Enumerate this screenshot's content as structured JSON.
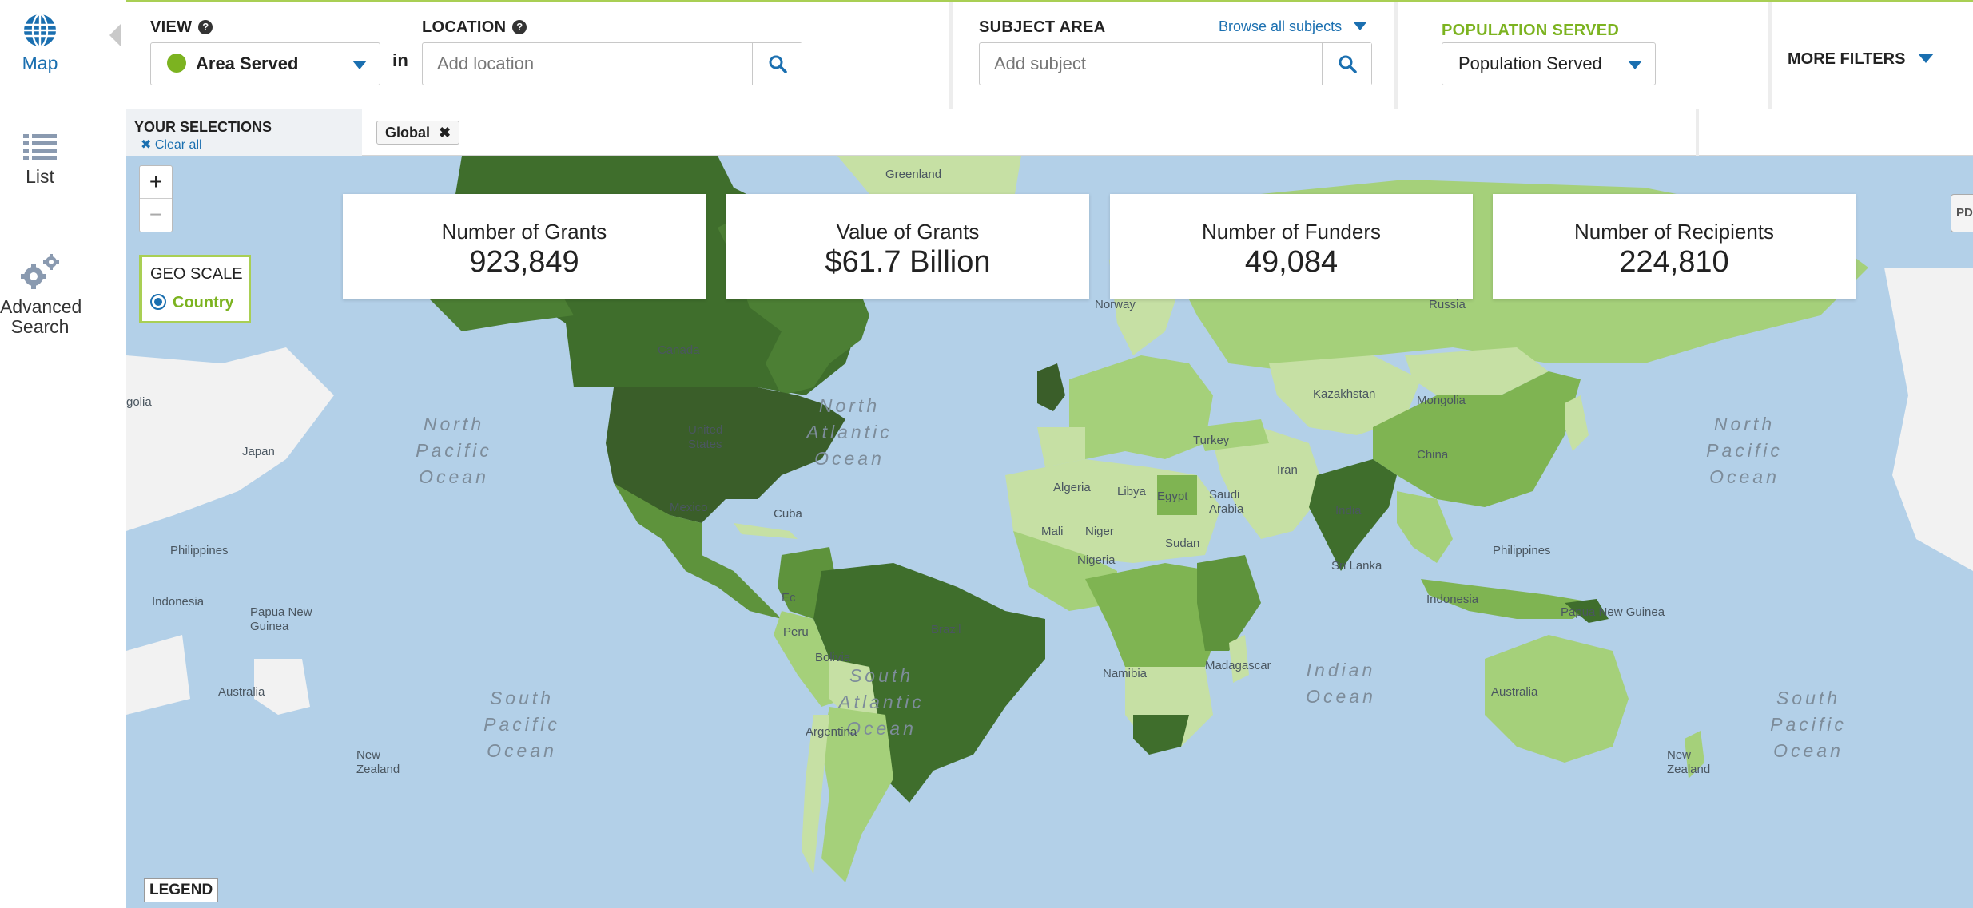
{
  "nav": {
    "map_label": "Map",
    "list_label": "List",
    "advanced_search_label": "Advanced Search"
  },
  "filters": {
    "view_label": "VIEW",
    "view_value": "Area Served",
    "in_label": "in",
    "location_label": "LOCATION",
    "location_placeholder": "Add location",
    "subject_label": "SUBJECT AREA",
    "browse_subjects": "Browse all subjects",
    "subject_placeholder": "Add subject",
    "population_label": "POPULATION SERVED",
    "population_value": "Population Served",
    "more_filters": "MORE FILTERS"
  },
  "selections": {
    "title": "YOUR SELECTIONS",
    "clear_all": "Clear all",
    "chip": "Global"
  },
  "map": {
    "zoom_in": "+",
    "zoom_out": "−",
    "geo_scale_title": "GEO SCALE",
    "geo_scale_option": "Country",
    "legend_label": "LEGEND",
    "pdf_label": "PDF",
    "oceans": {
      "north_pacific_west": "North Pacific Ocean",
      "north_atlantic": "North Atlantic Ocean",
      "north_pacific_east": "North Pacific Ocean",
      "south_pacific_west": "South Pacific Ocean",
      "south_atlantic": "South Atlantic Ocean",
      "indian": "Indian Ocean",
      "south_pacific_east": "South Pacific Ocean"
    },
    "places": {
      "greenland": "Greenland",
      "canada": "Canada",
      "united_states": "United States",
      "mexico": "Mexico",
      "brazil": "Brazil",
      "argentina": "Argentina",
      "russia": "Russia",
      "kazakhstan": "Kazakhstan",
      "mongolia": "Mongolia",
      "china": "China",
      "india": "India",
      "iran": "Iran",
      "algeria": "Algeria",
      "libya": "Libya",
      "egypt": "Egypt",
      "sudan": "Sudan",
      "niger": "Niger",
      "mali": "Mali",
      "nigeria": "Nigeria",
      "namibia": "Namibia",
      "madagascar": "Madagascar",
      "australia_west": "Australia",
      "australia": "Australia",
      "indonesia": "Indonesia",
      "philippines_west": "Philippines",
      "philippines": "Philippines",
      "papua_new_guinea": "Papua New Guinea",
      "japan": "Japan",
      "sri_lanka": "Sri Lanka",
      "new_zealand_west": "New Zealand",
      "new_zealand": "New Zealand",
      "cuba": "Cuba",
      "turkey": "Turkey",
      "norway": "Norway",
      "mongolia_west": "golia",
      "saudi_arabia": "Saudi Arabia",
      "ecuador": "Ec",
      "peru": "Peru",
      "bolivia": "Bolivia"
    },
    "colors": {
      "ocean": "#b3d0e8",
      "unshaded": "#f2f2f2",
      "shade1": "#c6e0a4",
      "shade2": "#a5d07a",
      "shade3": "#7fb452",
      "shade4": "#5e933c",
      "shade5": "#3f6e2c"
    }
  },
  "stats": [
    {
      "label": "Number of Grants",
      "value": "923,849"
    },
    {
      "label": "Value of Grants",
      "value": "$61.7 Billion"
    },
    {
      "label": "Number of Funders",
      "value": "49,084"
    },
    {
      "label": "Number of Recipients",
      "value": "224,810"
    }
  ],
  "theme": {
    "accent_green": "#a9cf54",
    "link_blue": "#1a6fb0",
    "population_green": "#7cb320"
  }
}
